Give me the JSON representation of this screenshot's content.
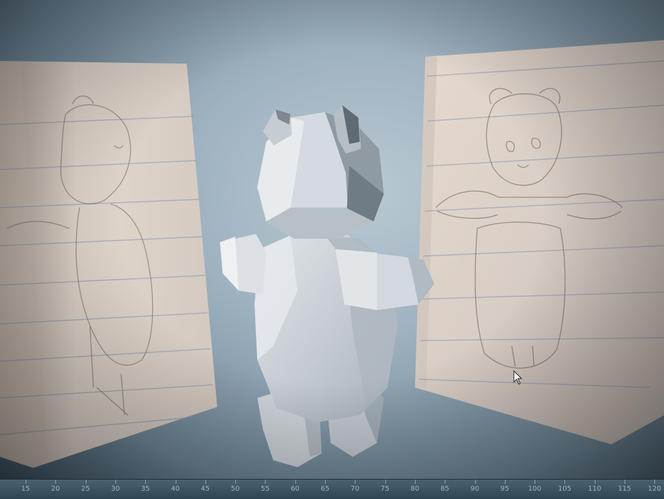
{
  "viewport": {
    "scene": "3D modeling viewport with low-poly bear model and two reference sketch image planes"
  },
  "reference_planes": [
    {
      "name": "side-view-reference",
      "content": "pencil sketch of bear, side view, on lined paper"
    },
    {
      "name": "front-view-reference",
      "content": "pencil sketch of bear, front view, on lined paper"
    }
  ],
  "model": {
    "name": "low-poly-bear-mesh",
    "color": "#d9dde2"
  },
  "timeline": {
    "ticks": [
      "15",
      "20",
      "25",
      "30",
      "35",
      "40",
      "45",
      "50",
      "55",
      "60",
      "65",
      "70",
      "75",
      "80",
      "85",
      "90",
      "95",
      "100",
      "105",
      "110",
      "115",
      "120"
    ]
  }
}
